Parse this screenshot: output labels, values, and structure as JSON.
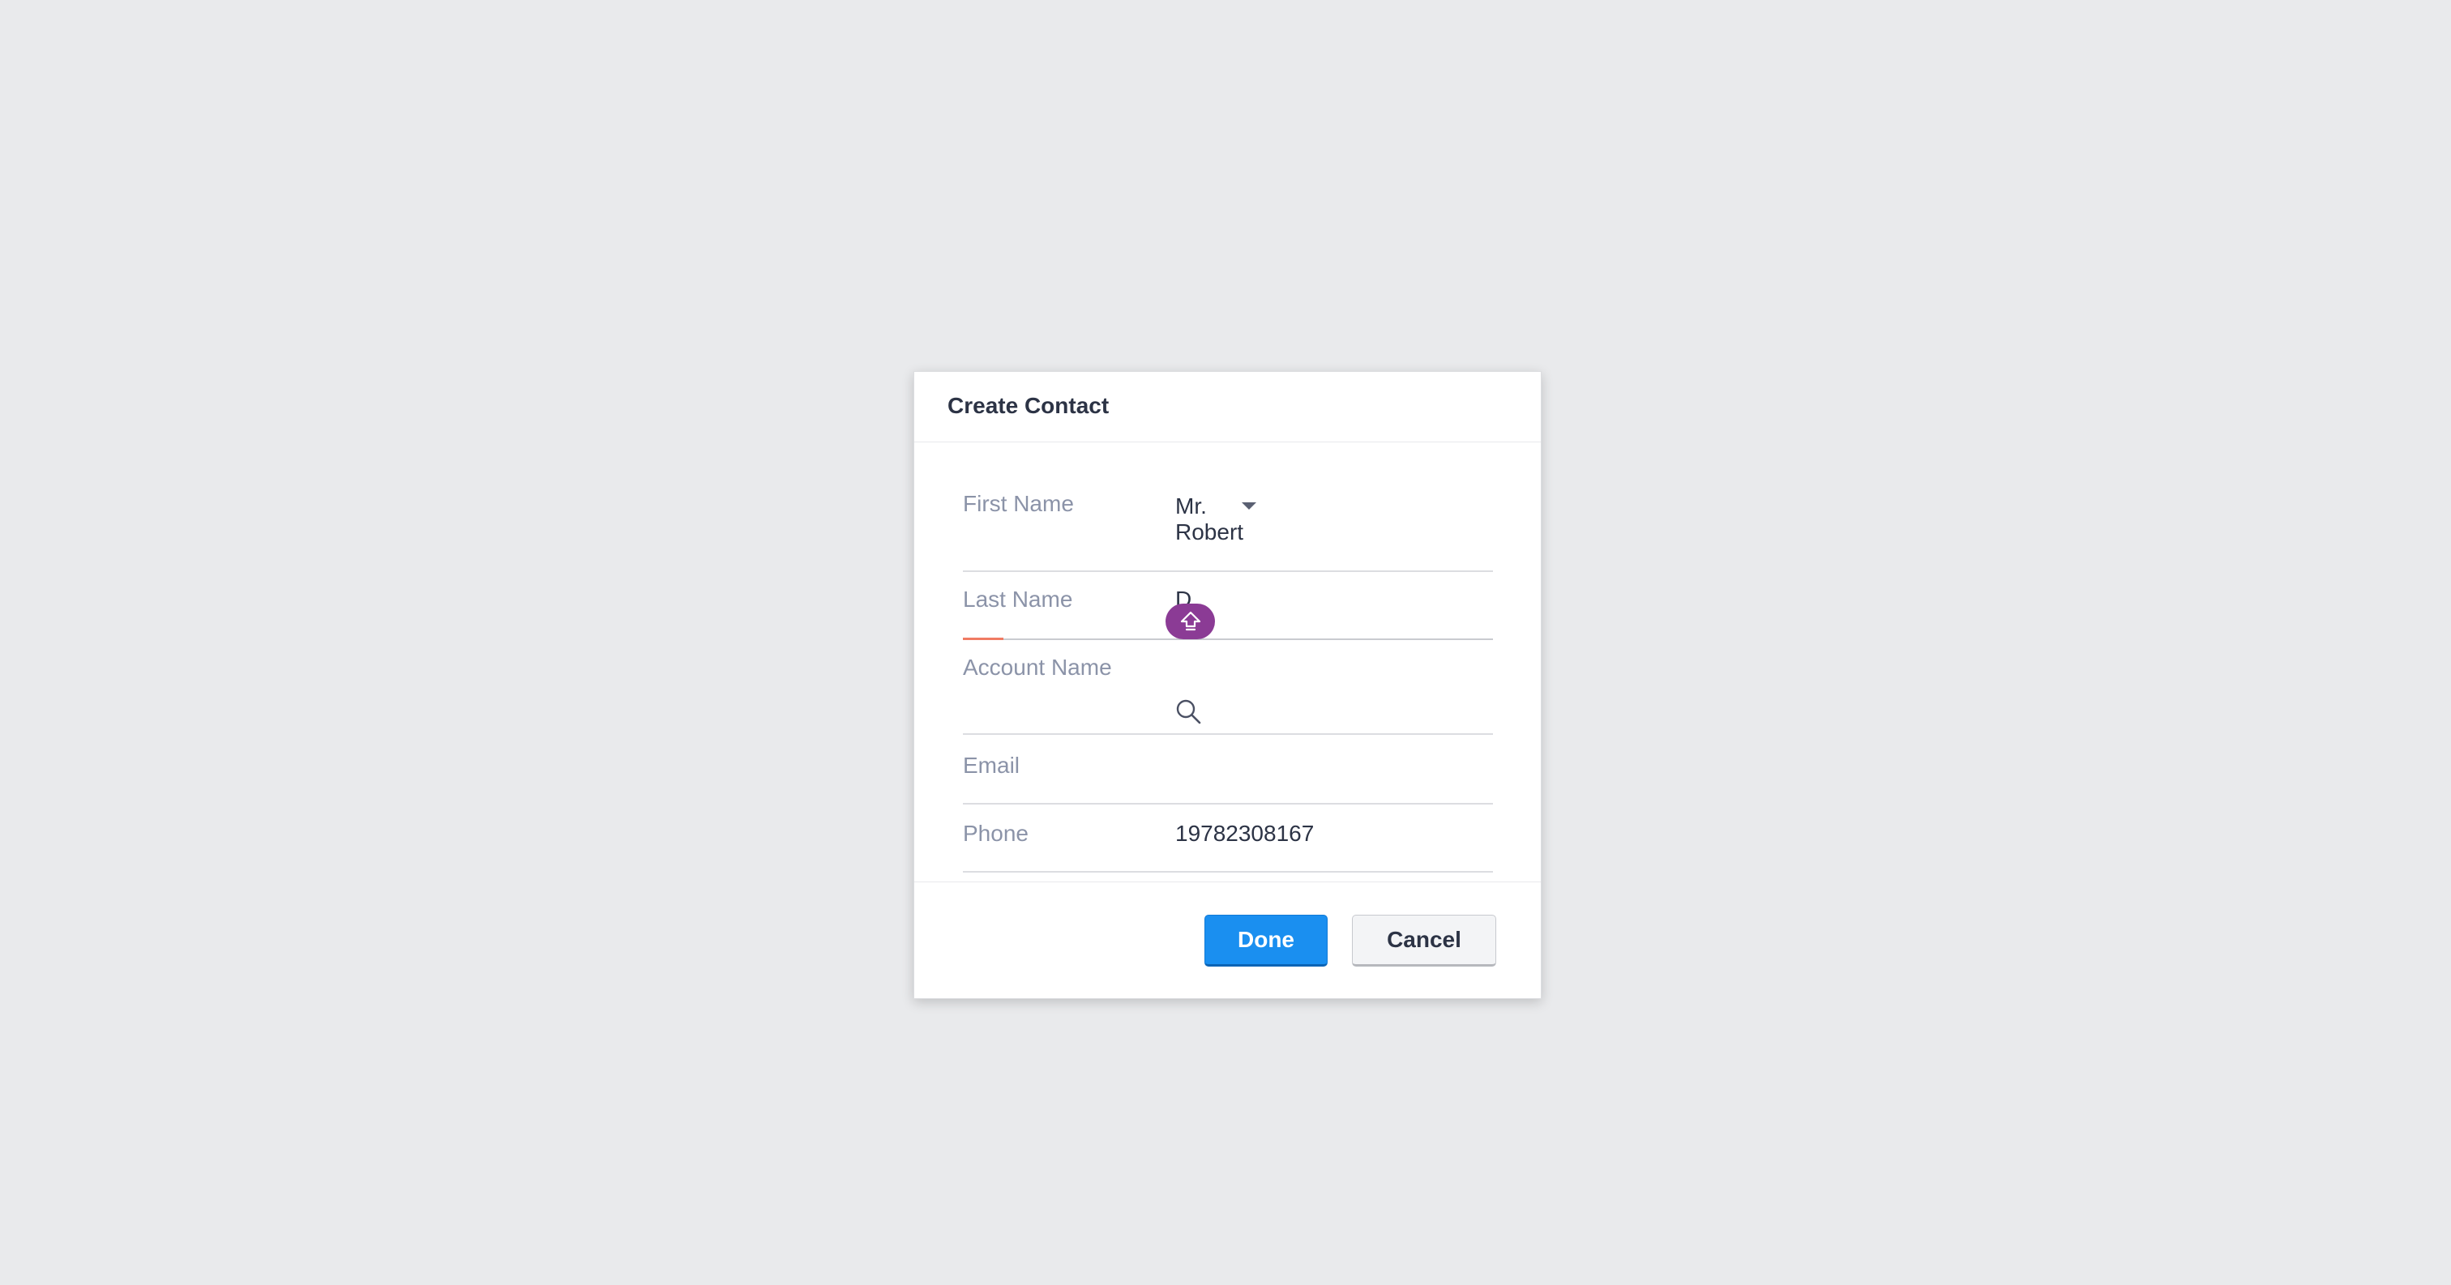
{
  "dialog": {
    "title": "Create Contact"
  },
  "form": {
    "first_name": {
      "label": "First Name",
      "salutation": "Mr.",
      "value": "Robert"
    },
    "last_name": {
      "label": "Last Name",
      "value": "D"
    },
    "account_name": {
      "label": "Account Name",
      "value": ""
    },
    "email": {
      "label": "Email",
      "value": ""
    },
    "phone": {
      "label": "Phone",
      "value": "19782308167"
    }
  },
  "buttons": {
    "done_label": "Done",
    "cancel_label": "Cancel"
  },
  "icons": {
    "salutation_dropdown": "chevron-down-icon",
    "autocomplete_bubble": "shift-arrow-icon",
    "account_search": "search-icon"
  },
  "colors": {
    "primary": "#1a8ff0",
    "bubble": "#8b3b95",
    "required": "#f07b63"
  }
}
